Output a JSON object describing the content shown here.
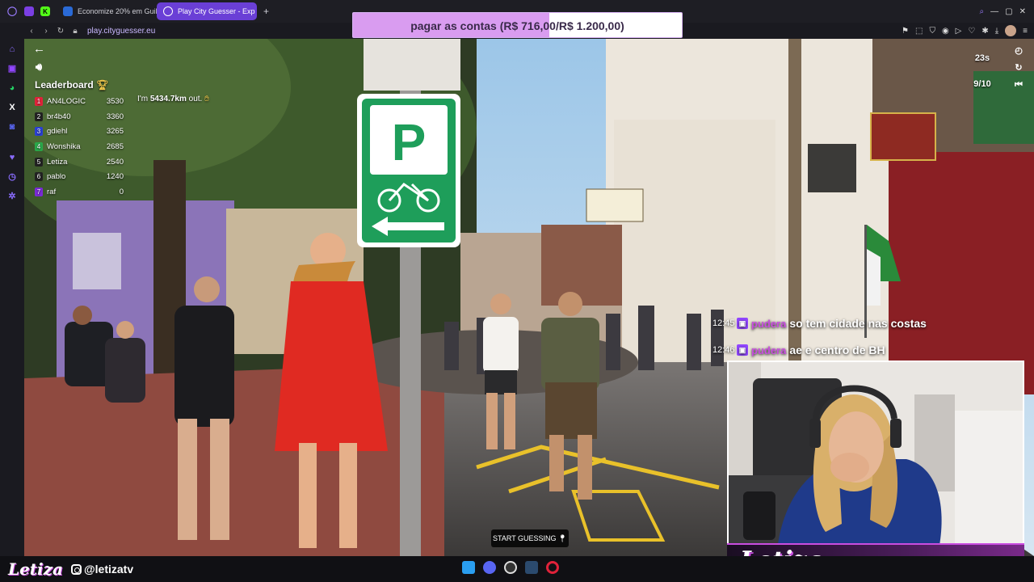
{
  "browser": {
    "tabs": [
      {
        "label": "Economize 20% em Guilty",
        "icon": "tag-icon",
        "active": false
      },
      {
        "label": "Play City Guesser - Exp",
        "icon": "globe-icon",
        "active": true
      }
    ],
    "url": "play.cityguesser.eu",
    "new_tab_symbol": "+"
  },
  "goal": {
    "text": "pagar as contas (R$ 716,00/R$ 1.200,00)",
    "current": 716,
    "target": 1200,
    "progress": 0.597
  },
  "game": {
    "leaderboard_title": "Leaderboard",
    "leaderboard": [
      {
        "rank": "1",
        "name": "AN4LOGIC",
        "score": "3530",
        "color": "#e0223a"
      },
      {
        "rank": "2",
        "name": "br4b40",
        "score": "3360",
        "color": "#222222"
      },
      {
        "rank": "3",
        "name": "gdiehl",
        "score": "3265",
        "color": "#2a3fd6"
      },
      {
        "rank": "4",
        "name": "Wonshika",
        "score": "2685",
        "color": "#2aa84a"
      },
      {
        "rank": "5",
        "name": "Letiza",
        "score": "2540",
        "color": "#222222"
      },
      {
        "rank": "6",
        "name": "pablo",
        "score": "1240",
        "color": "#222222"
      },
      {
        "rank": "7",
        "name": "raf",
        "score": "0",
        "color": "#7a2ad6"
      }
    ],
    "distance_prefix": "I'm",
    "distance_value": "5434.7km",
    "distance_suffix": "out.",
    "timer": "23s",
    "round": "9/10",
    "start_label": "START GUESSING"
  },
  "chat": [
    {
      "time": "12:45",
      "user": "pudera",
      "message": "so tem cidade nas costas"
    },
    {
      "time": "12:46",
      "user": "pudera",
      "message": "ae e centro de BH"
    }
  ],
  "streamer": {
    "name": "Letiza",
    "handle": "@letizatv"
  }
}
